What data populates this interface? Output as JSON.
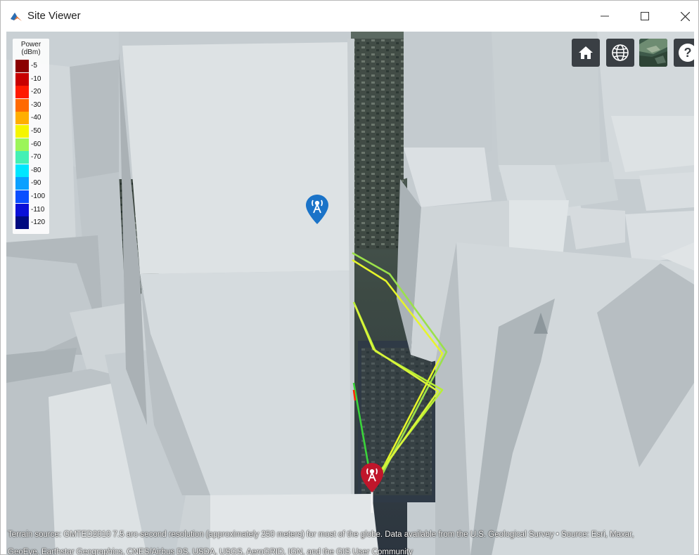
{
  "window": {
    "title": "Site Viewer",
    "controls": {
      "minimize": "—",
      "maximize": "☐",
      "close": "✕"
    }
  },
  "legend": {
    "title_line1": "Power",
    "title_line2": "(dBm)",
    "entries": [
      {
        "label": "-5",
        "color": "#8b0000"
      },
      {
        "label": "-10",
        "color": "#c80000"
      },
      {
        "label": "-20",
        "color": "#ff1a00"
      },
      {
        "label": "-30",
        "color": "#ff6a00"
      },
      {
        "label": "-40",
        "color": "#ffae00"
      },
      {
        "label": "-50",
        "color": "#f5f500"
      },
      {
        "label": "-60",
        "color": "#9cf55a"
      },
      {
        "label": "-70",
        "color": "#44f0b4"
      },
      {
        "label": "-80",
        "color": "#00e6ff"
      },
      {
        "label": "-90",
        "color": "#0aa0ff"
      },
      {
        "label": "-100",
        "color": "#0a4fff"
      },
      {
        "label": "-110",
        "color": "#0a10d8"
      },
      {
        "label": "-120",
        "color": "#000a80"
      }
    ]
  },
  "toolbar": {
    "home": "home-icon",
    "globe": "globe-icon",
    "basemap": "basemap-picker-icon",
    "help_label": "?"
  },
  "markers": {
    "transmitter": {
      "icon": "antenna-icon",
      "color": "#1a73c8"
    },
    "receiver": {
      "icon": "antenna-icon",
      "color": "#c0162b"
    }
  },
  "ray_colors": {
    "green": "#4ee03a",
    "lime": "#b8ef34",
    "yellow": "#e6f52a",
    "red": "#ff2a00"
  },
  "attribution": {
    "line1": "Terrain source: GMTED2010 7.5 arc-second resolution (approximately 250 meters) for most of the globe. Data available from the U.S. Geological Survey • Source: Esri, Maxar,",
    "line2": "GeoEye, Earthstar Geographics, CNES/Airbus DS, USDA, USGS, AeroGRID, IGN, and the GIS User Community"
  }
}
